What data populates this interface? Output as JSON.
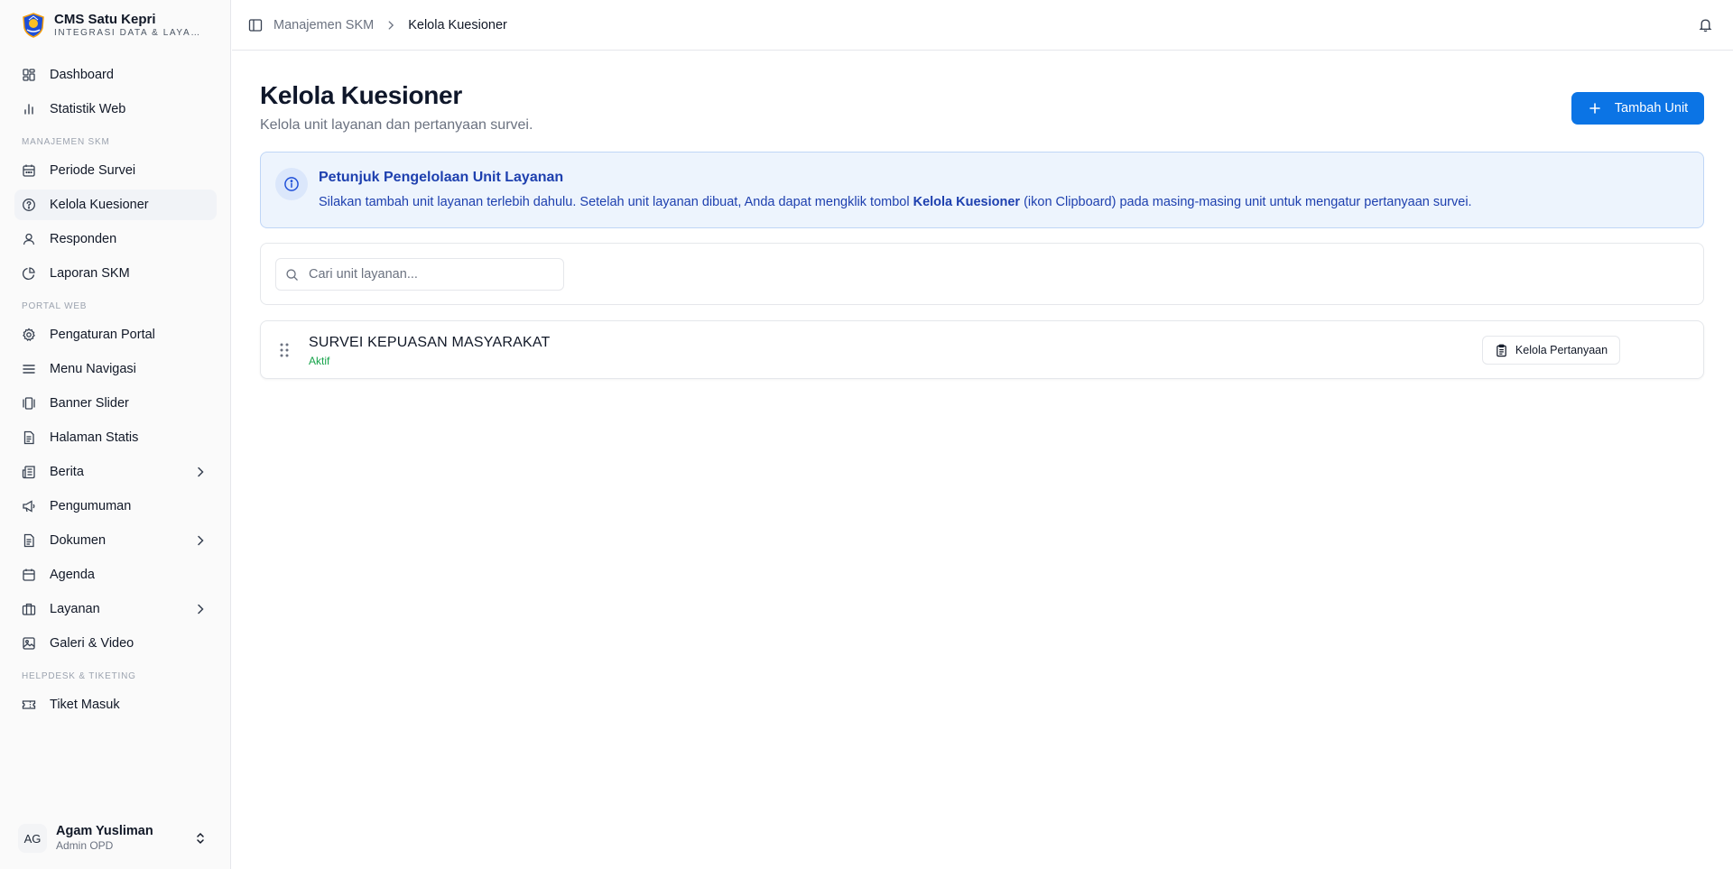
{
  "brand": {
    "title": "CMS Satu Kepri",
    "subtitle": "INTEGRASI DATA & LAYANAN"
  },
  "sidebar": {
    "top_items": [
      {
        "label": "Dashboard",
        "icon": "dashboard-icon"
      },
      {
        "label": "Statistik Web",
        "icon": "bar-chart-icon"
      }
    ],
    "groups": [
      {
        "label": "MANAJEMEN SKM",
        "items": [
          {
            "label": "Periode Survei",
            "icon": "calendar-icon"
          },
          {
            "label": "Kelola Kuesioner",
            "icon": "help-circle-icon",
            "active": true
          },
          {
            "label": "Responden",
            "icon": "user-icon"
          },
          {
            "label": "Laporan SKM",
            "icon": "pie-chart-icon"
          }
        ]
      },
      {
        "label": "PORTAL WEB",
        "items": [
          {
            "label": "Pengaturan Portal",
            "icon": "gear-icon"
          },
          {
            "label": "Menu Navigasi",
            "icon": "menu-icon"
          },
          {
            "label": "Banner Slider",
            "icon": "gallery-icon"
          },
          {
            "label": "Halaman Statis",
            "icon": "file-text-icon"
          },
          {
            "label": "Berita",
            "icon": "newspaper-icon",
            "expandable": true
          },
          {
            "label": "Pengumuman",
            "icon": "megaphone-icon"
          },
          {
            "label": "Dokumen",
            "icon": "file-text-icon",
            "expandable": true
          },
          {
            "label": "Agenda",
            "icon": "calendar-icon"
          },
          {
            "label": "Layanan",
            "icon": "briefcase-icon",
            "expandable": true
          },
          {
            "label": "Galeri & Video",
            "icon": "image-icon"
          }
        ]
      },
      {
        "label": "HELPDESK & TIKETING",
        "items": [
          {
            "label": "Tiket Masuk",
            "icon": "ticket-icon"
          }
        ]
      }
    ]
  },
  "user": {
    "initials": "AG",
    "name": "Agam Yusliman",
    "role": "Admin OPD"
  },
  "breadcrumb": {
    "parent": "Manajemen SKM",
    "current": "Kelola Kuesioner"
  },
  "page": {
    "title": "Kelola Kuesioner",
    "subtitle": "Kelola unit layanan dan pertanyaan survei.",
    "add_button": "Tambah Unit"
  },
  "info": {
    "title": "Petunjuk Pengelolaan Unit Layanan",
    "text_before": "Silakan tambah unit layanan terlebih dahulu. Setelah unit layanan dibuat, Anda dapat mengklik tombol ",
    "text_bold": "Kelola Kuesioner",
    "text_after": " (ikon Clipboard) pada masing-masing unit untuk mengatur pertanyaan survei."
  },
  "search": {
    "placeholder": "Cari unit layanan...",
    "value": ""
  },
  "units": [
    {
      "name": "SURVEI KEPUASAN MASYARAKAT",
      "status": "Aktif",
      "action": "Kelola Pertanyaan"
    }
  ],
  "colors": {
    "primary": "#0b74e5",
    "info_bg": "#edf4fd",
    "info_text": "#1e40af",
    "status_active": "#16a34a"
  }
}
